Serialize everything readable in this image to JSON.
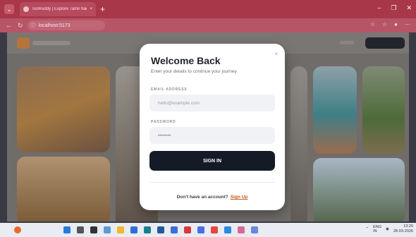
{
  "browser": {
    "tab_title": "TooRuddy | Explore Tamil Nadu",
    "url": "localhost:5173"
  },
  "modal": {
    "title": "Welcome Back",
    "subtitle": "Enter your details to continue your journey",
    "email_label": "EMAIL ADDRESS",
    "email_placeholder": "hello@example.com",
    "password_label": "PASSWORD",
    "password_value": "••••••••",
    "signin_label": "SIGN IN",
    "footer_text": "Don't have an account?",
    "signup_label": "Sign Up",
    "close_glyph": "×"
  },
  "taskbar": {
    "lang": "ENG",
    "lang2": "IN",
    "time": "13:20",
    "date": "28-03-2026"
  },
  "colors": {
    "tab_bar": "#a8374a",
    "primary_button": "#141a26",
    "signup_link": "#c05a1e"
  }
}
